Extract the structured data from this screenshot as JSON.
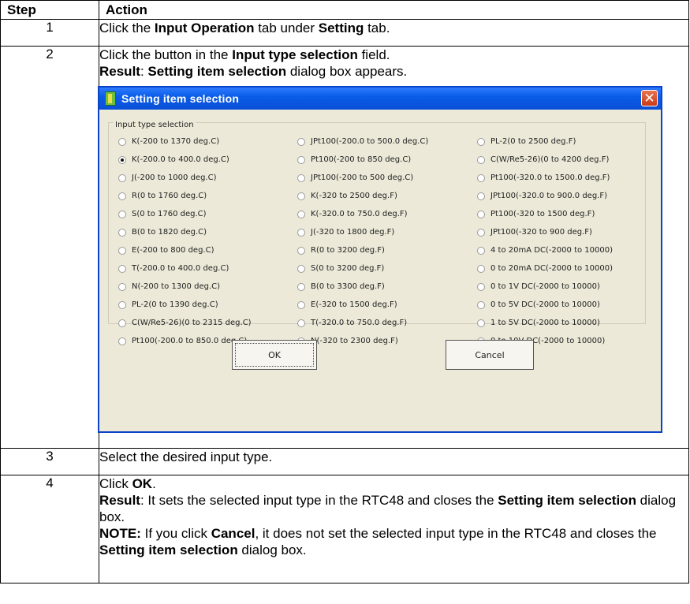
{
  "headers": {
    "step": "Step",
    "action": "Action"
  },
  "rows": [
    {
      "step": "1",
      "parts": [
        "Click the ",
        "Input Operation",
        " tab under ",
        "Setting",
        " tab."
      ]
    },
    {
      "step": "2",
      "line1": [
        "Click the button in the ",
        "Input type selection",
        " field."
      ],
      "line2": [
        "Result",
        ": ",
        "Setting item selection",
        " dialog box appears."
      ]
    },
    {
      "step": "3",
      "text": "Select the desired input type."
    },
    {
      "step": "4",
      "line1": [
        "Click ",
        "OK",
        "."
      ],
      "line2": [
        "Result",
        ": It sets the selected input type in the RTC48 and closes the ",
        "Setting item selection",
        " dialog box."
      ],
      "line3": [
        "NOTE:",
        " If you click ",
        "Cancel",
        ", it does not set the selected input type in the RTC48 and closes the ",
        "Setting item selection",
        " dialog box."
      ]
    }
  ],
  "dialog": {
    "title": "Setting item selection",
    "close_symbol": "✕",
    "group_label": "Input type selection",
    "selected": "K(-200.0 to 400.0 deg.C)",
    "columns": [
      [
        "K(-200 to 1370 deg.C)",
        "K(-200.0 to 400.0 deg.C)",
        "J(-200 to 1000 deg.C)",
        "R(0 to 1760 deg.C)",
        "S(0 to 1760 deg.C)",
        "B(0 to 1820 deg.C)",
        "E(-200 to 800 deg.C)",
        "T(-200.0 to 400.0 deg.C)",
        "N(-200 to 1300 deg.C)",
        "PL-2(0 to 1390 deg.C)",
        "C(W/Re5-26)(0 to 2315 deg.C)",
        "Pt100(-200.0 to 850.0 deg.C)"
      ],
      [
        "JPt100(-200.0 to 500.0 deg.C)",
        "Pt100(-200 to 850 deg.C)",
        "JPt100(-200 to 500 deg.C)",
        "K(-320 to 2500 deg.F)",
        "K(-320.0 to 750.0 deg.F)",
        "J(-320 to 1800 deg.F)",
        "R(0 to 3200 deg.F)",
        "S(0 to 3200 deg.F)",
        "B(0 to 3300 deg.F)",
        "E(-320 to 1500 deg.F)",
        "T(-320.0 to 750.0 deg.F)",
        "N(-320 to 2300 deg.F)"
      ],
      [
        "PL-2(0 to 2500 deg.F)",
        "C(W/Re5-26)(0 to 4200 deg.F)",
        "Pt100(-320.0 to 1500.0 deg.F)",
        "JPt100(-320.0 to 900.0 deg.F)",
        "Pt100(-320 to 1500 deg.F)",
        "JPt100(-320 to 900 deg.F)",
        "4 to 20mA DC(-2000 to 10000)",
        "0 to 20mA DC(-2000 to 10000)",
        "0 to 1V DC(-2000 to 10000)",
        "0 to 5V DC(-2000 to 10000)",
        "1 to 5V DC(-2000 to 10000)",
        "0 to 10V DC(-2000 to 10000)"
      ]
    ],
    "ok_label": "OK",
    "cancel_label": "Cancel"
  }
}
